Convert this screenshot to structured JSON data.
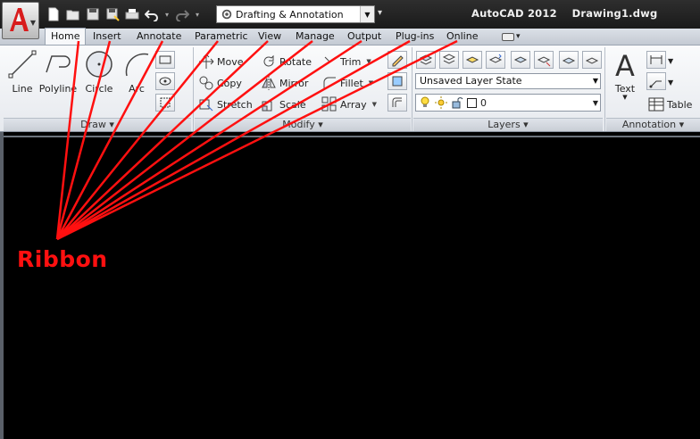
{
  "window": {
    "title": "AutoCAD 2012    Drawing1.dwg"
  },
  "quick_access": {
    "workspace": "Drafting & Annotation",
    "buttons": [
      "new-icon",
      "open-icon",
      "save-icon",
      "save-as-icon",
      "plot-icon",
      "undo-icon",
      "redo-icon"
    ]
  },
  "tabs": [
    "Home",
    "Insert",
    "Annotate",
    "Parametric",
    "View",
    "Manage",
    "Output",
    "Plug-ins",
    "Online"
  ],
  "active_tab": "Home",
  "ribbon": {
    "draw": {
      "label": "Draw",
      "tools": [
        "Line",
        "Polyline",
        "Circle",
        "Arc"
      ]
    },
    "modify": {
      "label": "Modify",
      "tools": [
        "Move",
        "Rotate",
        "Trim",
        "Copy",
        "Mirror",
        "Fillet",
        "Stretch",
        "Scale",
        "Array"
      ]
    },
    "layers": {
      "label": "Layers",
      "layer_state": "Unsaved Layer State",
      "current_layer": "0"
    },
    "annotation": {
      "label": "Annotation",
      "text": "Text",
      "table": "Table"
    }
  },
  "annotation_label": "Ribbon",
  "colors": {
    "annotation": "#ff1010",
    "canvas": "#000000"
  }
}
